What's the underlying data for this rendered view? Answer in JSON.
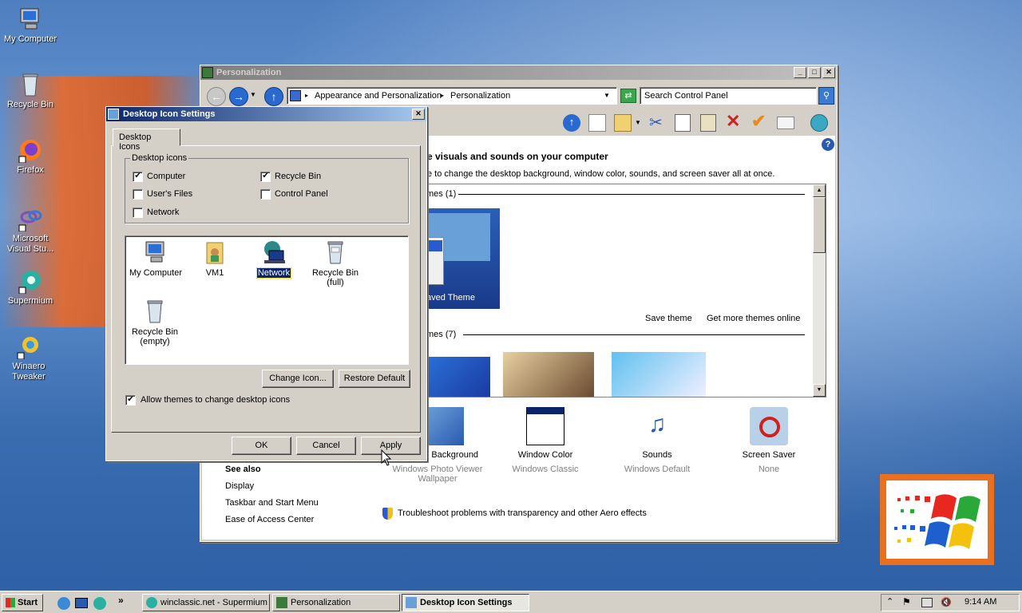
{
  "desktop": {
    "icons": [
      {
        "label": "My Computer"
      },
      {
        "label": "Recycle Bin"
      },
      {
        "label": "Firefox"
      },
      {
        "label": "Microsoft Visual Stu..."
      },
      {
        "label": "Supermium"
      },
      {
        "label": "Winaero Tweaker"
      }
    ]
  },
  "personalization": {
    "title": "Personalization",
    "breadcrumb": [
      "Appearance and Personalization",
      "Personalization"
    ],
    "search_placeholder": "Search Control Panel",
    "heading": "e visuals and sounds on your computer",
    "subheading": "e to change the desktop background, window color, sounds, and screen saver all at once.",
    "my_themes_label": "mes (1)",
    "saved_theme_label": "aved Theme",
    "save_theme": "Save theme",
    "get_more_themes": "Get more themes online",
    "aero_themes_label": "mes (7)",
    "bottom_items": [
      {
        "title": "Desktop Background",
        "sub": "Windows Photo Viewer Wallpaper"
      },
      {
        "title": "Window Color",
        "sub": "Windows Classic"
      },
      {
        "title": "Sounds",
        "sub": "Windows Default"
      },
      {
        "title": "Screen Saver",
        "sub": "None"
      }
    ],
    "see_also": "See also",
    "see_also_links": [
      "Display",
      "Taskbar and Start Menu",
      "Ease of Access Center"
    ],
    "troubleshoot": "Troubleshoot problems with transparency and other Aero effects"
  },
  "dialog": {
    "title": "Desktop Icon Settings",
    "tab": "Desktop Icons",
    "group_label": "Desktop icons",
    "checkboxes": [
      {
        "label": "Computer",
        "checked": "✔"
      },
      {
        "label": "Recycle Bin",
        "checked": "✔"
      },
      {
        "label": "User's Files",
        "checked": ""
      },
      {
        "label": "Control Panel",
        "checked": ""
      },
      {
        "label": "Network",
        "checked": ""
      }
    ],
    "icons": [
      {
        "label": "My Computer"
      },
      {
        "label": "VM1"
      },
      {
        "label": "Network"
      },
      {
        "label": "Recycle Bin (full)"
      },
      {
        "label": "Recycle Bin (empty)"
      }
    ],
    "change_icon": "Change Icon...",
    "restore_default": "Restore Default",
    "allow_themes": "Allow themes to change desktop icons",
    "allow_checked": "✔",
    "ok": "OK",
    "cancel": "Cancel",
    "apply": "Apply"
  },
  "taskbar": {
    "start": "Start",
    "quick_more": "»",
    "items": [
      "winclassic.net - Supermium",
      "Personalization",
      "Desktop Icon Settings"
    ],
    "time": "9:14 AM"
  }
}
